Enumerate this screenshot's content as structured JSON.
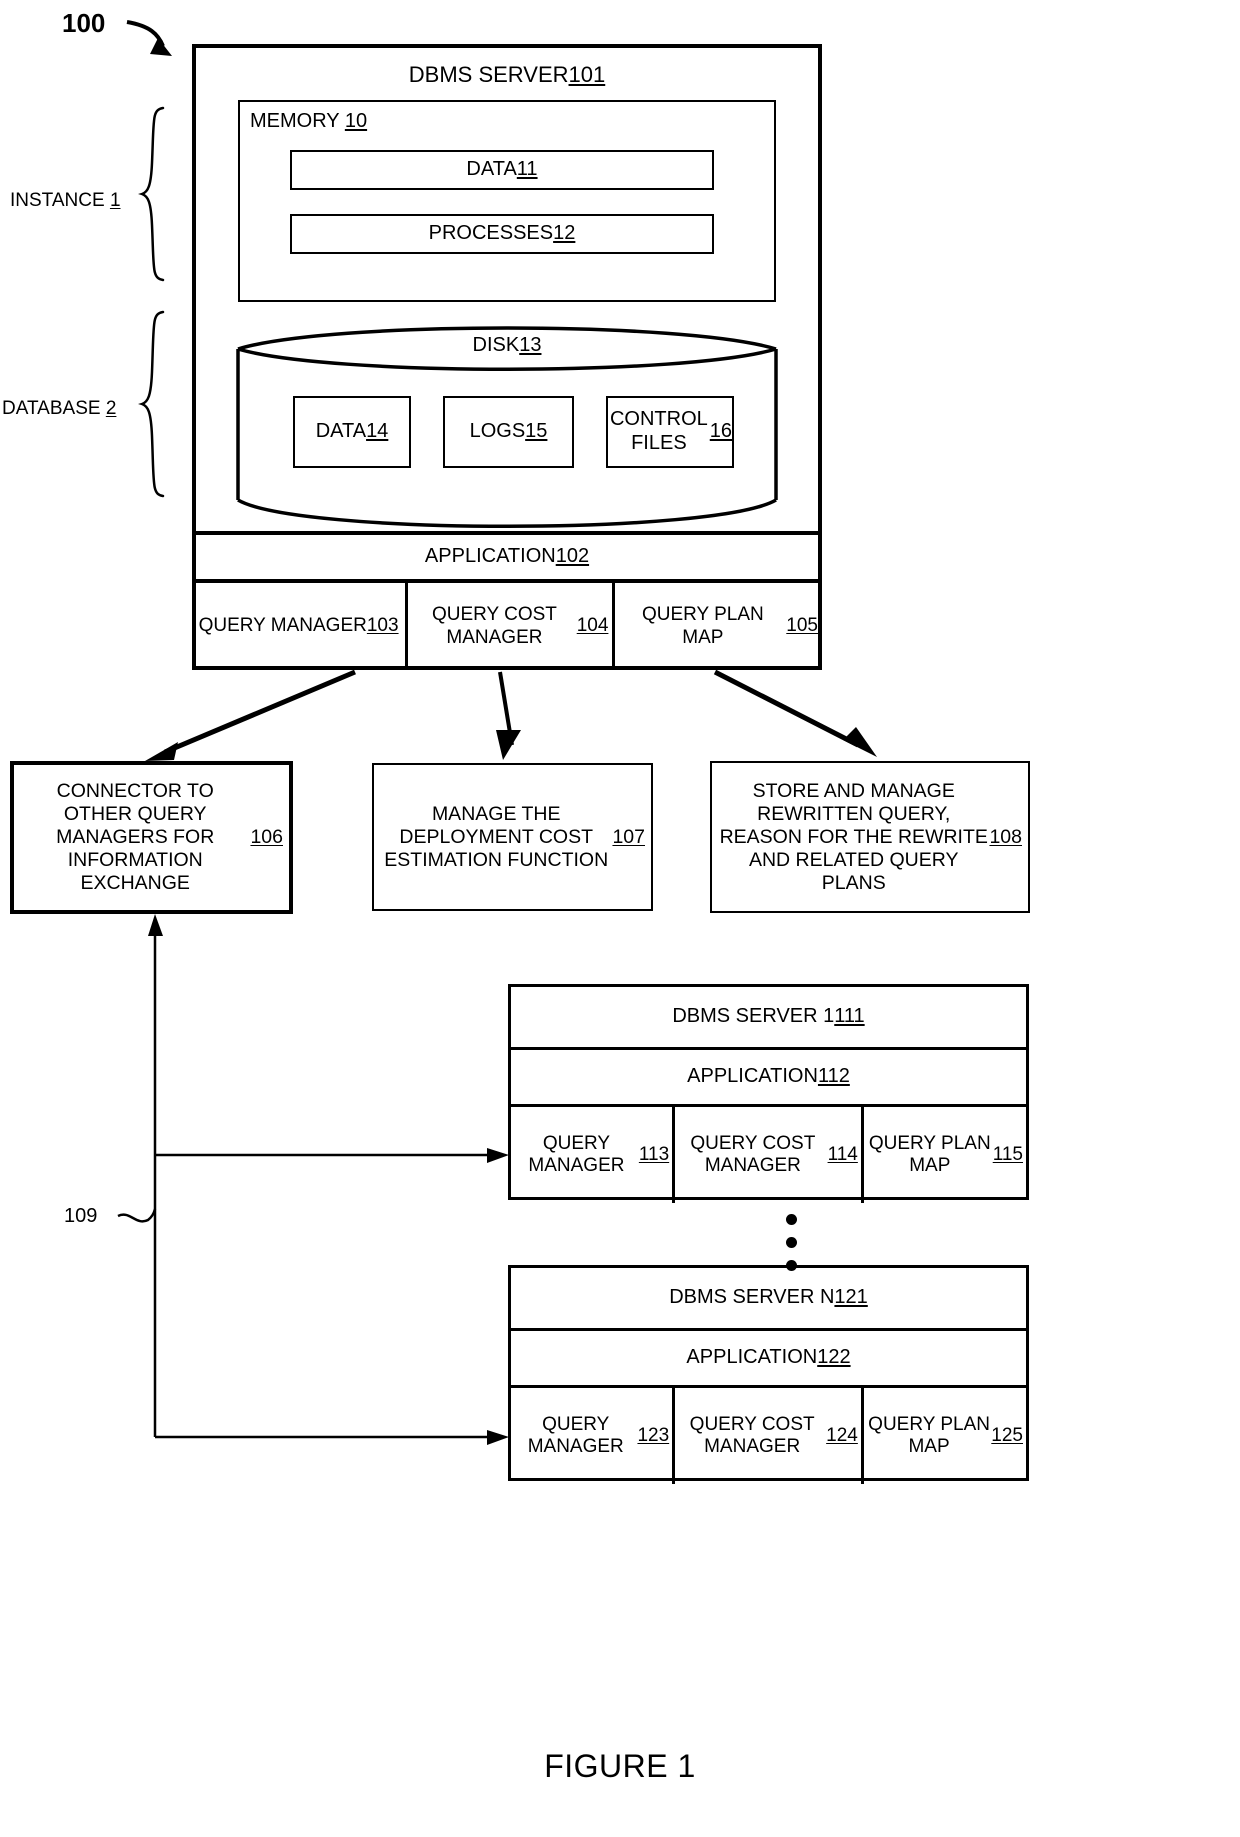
{
  "figure": {
    "caption": "FIGURE 1",
    "ref_main": "100",
    "ref_cluster": "109"
  },
  "left_labels": {
    "instance": "INSTANCE 1",
    "database": "DATABASE 2"
  },
  "server_main": {
    "title": "DBMS SERVER 101",
    "memory": {
      "label": "MEMORY 10",
      "items": [
        {
          "label": "DATA 11"
        },
        {
          "label": "PROCESSES 12"
        }
      ]
    },
    "disk": {
      "label": "DISK 13",
      "items": [
        {
          "label": "DATA 14"
        },
        {
          "label": "LOGS 15"
        },
        {
          "label": "CONTROL FILES 16"
        }
      ]
    },
    "application": "APPLICATION 102",
    "components": [
      {
        "label": "QUERY MANAGER 103"
      },
      {
        "label": "QUERY COST MANAGER 104"
      },
      {
        "label": "QUERY PLAN MAP 105"
      }
    ]
  },
  "actions": [
    {
      "label": "CONNECTOR TO OTHER QUERY MANAGERS FOR INFORMATION EXCHANGE 106"
    },
    {
      "label": "MANAGE THE DEPLOYMENT COST ESTIMATION FUNCTION 107"
    },
    {
      "label": "STORE AND MANAGE REWRITTEN QUERY, REASON FOR THE REWRITE AND RELATED QUERY PLANS 108"
    }
  ],
  "servers": [
    {
      "title": "DBMS SERVER 1 111",
      "application": "APPLICATION 112",
      "components": [
        {
          "label": "QUERY MANAGER 113"
        },
        {
          "label": "QUERY COST MANAGER 114"
        },
        {
          "label": "QUERY PLAN MAP 115"
        }
      ]
    },
    {
      "title": "DBMS SERVER N 121",
      "application": "APPLICATION 122",
      "components": [
        {
          "label": "QUERY MANAGER 123"
        },
        {
          "label": "QUERY COST MANAGER 124"
        },
        {
          "label": "QUERY PLAN MAP 125"
        }
      ]
    }
  ]
}
